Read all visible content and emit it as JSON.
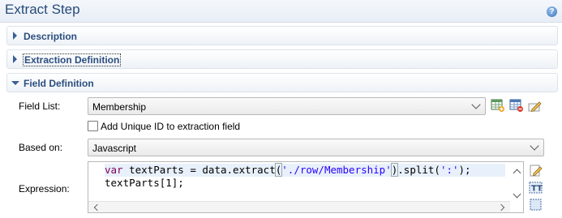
{
  "header": {
    "title": "Extract Step",
    "help_icon": "help-icon"
  },
  "sections": [
    {
      "label": "Description",
      "expanded": false
    },
    {
      "label": "Extraction Definition",
      "expanded": false
    },
    {
      "label": "Field Definition",
      "expanded": true
    }
  ],
  "field_definition": {
    "field_list_label": "Field List:",
    "field_list_value": "Membership",
    "toolbar_icons": [
      "add-field-icon",
      "remove-field-icon",
      "edit-field-icon"
    ],
    "unique_id_label": "Add Unique ID to extraction field",
    "unique_id_checked": false,
    "based_on_label": "Based on:",
    "based_on_value": "Javascript",
    "expression_label": "Expression:",
    "expression_lines": [
      "var textParts = data.extract('./row/Membership').split(':');",
      "textParts[1];"
    ],
    "expression_icons": [
      "edit-expression-icon",
      "text-icon",
      "select-area-icon"
    ]
  }
}
